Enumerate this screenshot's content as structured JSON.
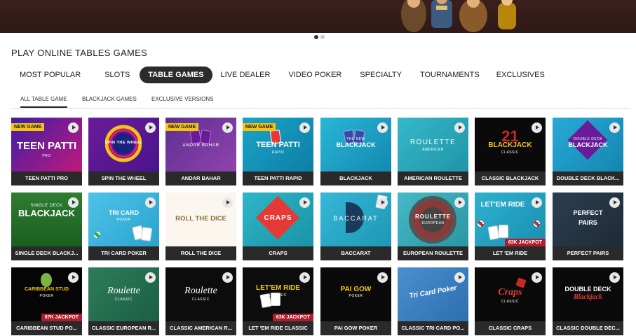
{
  "hero": {
    "slides": 2,
    "active_slide": 1
  },
  "section_title": "PLAY ONLINE TABLES GAMES",
  "main_tabs": [
    {
      "label": "MOST POPULAR"
    },
    {
      "label": "SLOTS"
    },
    {
      "label": "TABLE GAMES",
      "active": true
    },
    {
      "label": "LIVE DEALER"
    },
    {
      "label": "VIDEO POKER"
    },
    {
      "label": "SPECIALTY"
    },
    {
      "label": "TOURNAMENTS"
    },
    {
      "label": "EXCLUSIVES"
    }
  ],
  "sub_tabs": [
    {
      "label": "ALL TABLE GAME",
      "active": true
    },
    {
      "label": "BLACKJACK GAMES"
    },
    {
      "label": "EXCLUSIVE VERSIONS"
    }
  ],
  "tiles": [
    {
      "caption": "TEEN PATTI PRO",
      "badge": "NEW GAME",
      "logo": "TEEN PATTI",
      "sub": "PRO"
    },
    {
      "caption": "SPIN THE WHEEL",
      "logo": "SPIN THE WHEEL"
    },
    {
      "caption": "ANDAR BAHAR",
      "badge": "NEW GAME",
      "logo": "ANDAR BAHAR"
    },
    {
      "caption": "TEEN PATTI RAPID",
      "badge": "NEW GAME",
      "logo": "TEEN PATTI",
      "sub": "RAPID"
    },
    {
      "caption": "BLACKJACK",
      "logo": "BLACKJACK",
      "sub": "THE NEW"
    },
    {
      "caption": "AMERICAN ROULETTE",
      "logo": "ROULETTE",
      "sub": "AMERICAN"
    },
    {
      "caption": "CLASSIC BLACKJACK",
      "logo": "BLACKJACK",
      "sub": "CLASSIC"
    },
    {
      "caption": "DOUBLE DECK BLACK...",
      "logo": "BLACKJACK",
      "sub": "DOUBLE DECK"
    },
    {
      "caption": "SINGLE DECK BLACKJ...",
      "logo": "BLACKJACK",
      "sub": "SINGLE DECK"
    },
    {
      "caption": "TRI CARD POKER",
      "logo": "TRI CARD",
      "sub": "POKER"
    },
    {
      "caption": "ROLL THE DICE",
      "logo": "ROLL THE DICE"
    },
    {
      "caption": "CRAPS",
      "logo": "CRAPS"
    },
    {
      "caption": "BACCARAT",
      "logo": "BACCARAT"
    },
    {
      "caption": "EUROPEAN ROULETTE",
      "logo": "ROULETTE",
      "sub": "EUROPEAN"
    },
    {
      "caption": "LET 'EM RIDE",
      "logo": "LET'EM RIDE",
      "jackpot": "63K JACKPOT"
    },
    {
      "caption": "PERFECT PAIRS",
      "logo": "PERFECT PAIRS"
    },
    {
      "caption": "CARIBBEAN STUD PO...",
      "logo": "CARIBBEAN STUD",
      "sub": "POKER",
      "jackpot": "87K JACKPOT"
    },
    {
      "caption": "CLASSIC EUROPEAN R...",
      "logo": "Roulette",
      "sub": "CLASSIC"
    },
    {
      "caption": "CLASSIC AMERICAN R...",
      "logo": "Roulette",
      "sub": "CLASSIC"
    },
    {
      "caption": "LET 'EM RIDE CLASSIC",
      "logo": "LET'EM RIDE",
      "sub": "CLASSIC",
      "jackpot": "63K JACKPOT"
    },
    {
      "caption": "PAI GOW POKER",
      "logo": "PAI GOW",
      "sub": "POKER"
    },
    {
      "caption": "CLASSIC TRI CARD PO...",
      "logo": "Tri Card Poker"
    },
    {
      "caption": "CLASSIC CRAPS",
      "logo": "Craps",
      "sub": "CLASSIC"
    },
    {
      "caption": "CLASSIC DOUBLE DEC...",
      "logo": "DOUBLE DECK",
      "sub": "Blackjack"
    }
  ],
  "colors": {
    "hero": "#3a1f1d",
    "caption_bg": "#2a2a2a",
    "badge_new": "#f3c316",
    "badge_jackpot": "#b01e2e",
    "active_tab": "#2b2b2b"
  }
}
